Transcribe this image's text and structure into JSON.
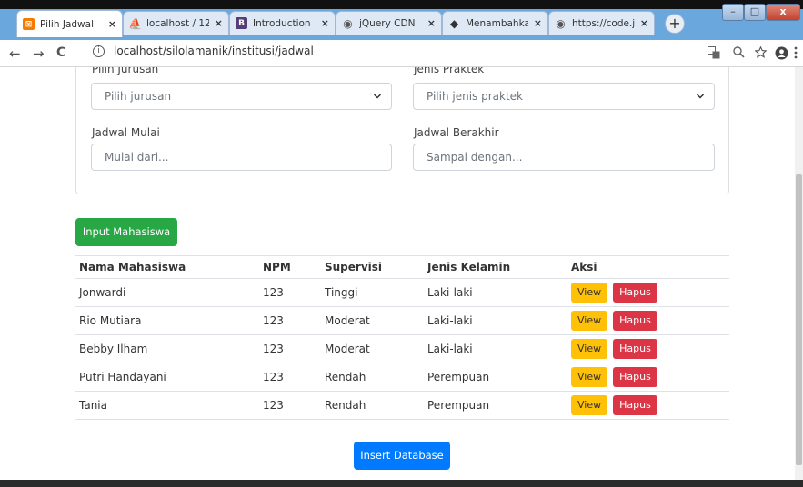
{
  "tabs": [
    {
      "label": "Pilih Jadwal",
      "icon": "xampp-icon",
      "color": "#f57c00",
      "active": true
    },
    {
      "label": "localhost / 12",
      "icon": "phpmyadmin-icon",
      "color": "#f0a500"
    },
    {
      "label": "Introduction",
      "icon": "bootstrap-icon",
      "color": "#563d7c"
    },
    {
      "label": "jQuery CDN",
      "icon": "globe-icon",
      "color": "#555555"
    },
    {
      "label": "Menambahka",
      "icon": "stackexchange-icon",
      "color": "#333333"
    },
    {
      "label": "https://code.j",
      "icon": "globe-icon",
      "color": "#555555"
    }
  ],
  "window_controls": {
    "minimize": "–",
    "maximize": "□",
    "close": "x"
  },
  "toolbar": {
    "url": "localhost/silolamanik/institusi/jadwal",
    "back": "←",
    "forward": "→",
    "reload": "C",
    "info": "i",
    "new_tab": "+",
    "tab_close": "×"
  },
  "form": {
    "jurusan_label": "Pilih Jurusan",
    "jurusan_placeholder": "Pilih jurusan",
    "praktek_label": "Jenis Praktek",
    "praktek_placeholder": "Pilih jenis praktek",
    "mulai_label": "Jadwal Mulai",
    "mulai_placeholder": "Mulai dari...",
    "berakhir_label": "Jadwal Berakhir",
    "berakhir_placeholder": "Sampai dengan..."
  },
  "input_button": "Input Mahasiswa",
  "table": {
    "headers": [
      "Nama Mahasiswa",
      "NPM",
      "Supervisi",
      "Jenis Kelamin",
      "Aksi"
    ],
    "rows": [
      {
        "nama": "Jonwardi",
        "npm": "123",
        "supervisi": "Tinggi",
        "jk": "Laki-laki"
      },
      {
        "nama": "Rio Mutiara",
        "npm": "123",
        "supervisi": "Moderat",
        "jk": "Laki-laki"
      },
      {
        "nama": "Bebby Ilham",
        "npm": "123",
        "supervisi": "Moderat",
        "jk": "Laki-laki"
      },
      {
        "nama": "Putri Handayani",
        "npm": "123",
        "supervisi": "Rendah",
        "jk": "Perempuan"
      },
      {
        "nama": "Tania",
        "npm": "123",
        "supervisi": "Rendah",
        "jk": "Perempuan"
      }
    ],
    "view_label": "View",
    "hapus_label": "Hapus"
  },
  "insert_button": "Insert Database",
  "colors": {
    "green": "#28a745",
    "blue": "#007bff",
    "yellow": "#ffc107",
    "red": "#dc3545"
  }
}
